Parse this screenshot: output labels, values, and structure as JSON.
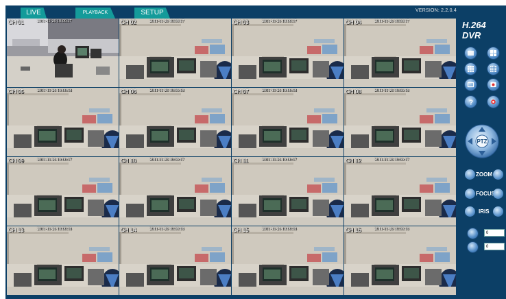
{
  "tabs": [
    {
      "label": "LIVE"
    },
    {
      "label": "PLAYBACK"
    },
    {
      "label": "SETUP"
    }
  ],
  "version": "VERSION: 2.2.0.4",
  "brand": "H.264 DVR",
  "channels": [
    {
      "label": "CH 01",
      "timestamp": "2011-11-26 10:00:17"
    },
    {
      "label": "CH 02",
      "timestamp": "2011-11-26 10:00:17"
    },
    {
      "label": "CH 03",
      "timestamp": "2011-11-26 10:00:17"
    },
    {
      "label": "CH 04",
      "timestamp": "2011-11-26 10:00:17"
    },
    {
      "label": "CH 05",
      "timestamp": "2011-11-26 10:00:18"
    },
    {
      "label": "CH 06",
      "timestamp": "2011-11-26 10:00:18"
    },
    {
      "label": "CH 07",
      "timestamp": "2011-11-26 10:00:18"
    },
    {
      "label": "CH 08",
      "timestamp": "2011-11-26 10:00:18"
    },
    {
      "label": "CH 09",
      "timestamp": "2011-11-26 10:00:17"
    },
    {
      "label": "CH 10",
      "timestamp": "2011-11-26 10:00:17"
    },
    {
      "label": "CH 11",
      "timestamp": "2011-11-26 10:00:17"
    },
    {
      "label": "CH 12",
      "timestamp": "2011-11-26 10:00:17"
    },
    {
      "label": "CH 13",
      "timestamp": "2011-11-26 10:00:18"
    },
    {
      "label": "CH 14",
      "timestamp": "2011-11-26 10:00:18"
    },
    {
      "label": "CH 15",
      "timestamp": "2011-11-26 10:00:18"
    },
    {
      "label": "CH 16",
      "timestamp": "2011-11-26 10:00:18"
    }
  ],
  "selected_channel": "CH 11",
  "ptz": {
    "center_label": "PTZ",
    "zoom_label": "ZOOM",
    "focus_label": "FOCUS",
    "iris_label": "IRIS",
    "speed_value": "0",
    "preset_value": "0"
  },
  "colors": {
    "background": "#0c3f66",
    "tab": "#149b9a",
    "selection": "#3a3fb0"
  }
}
